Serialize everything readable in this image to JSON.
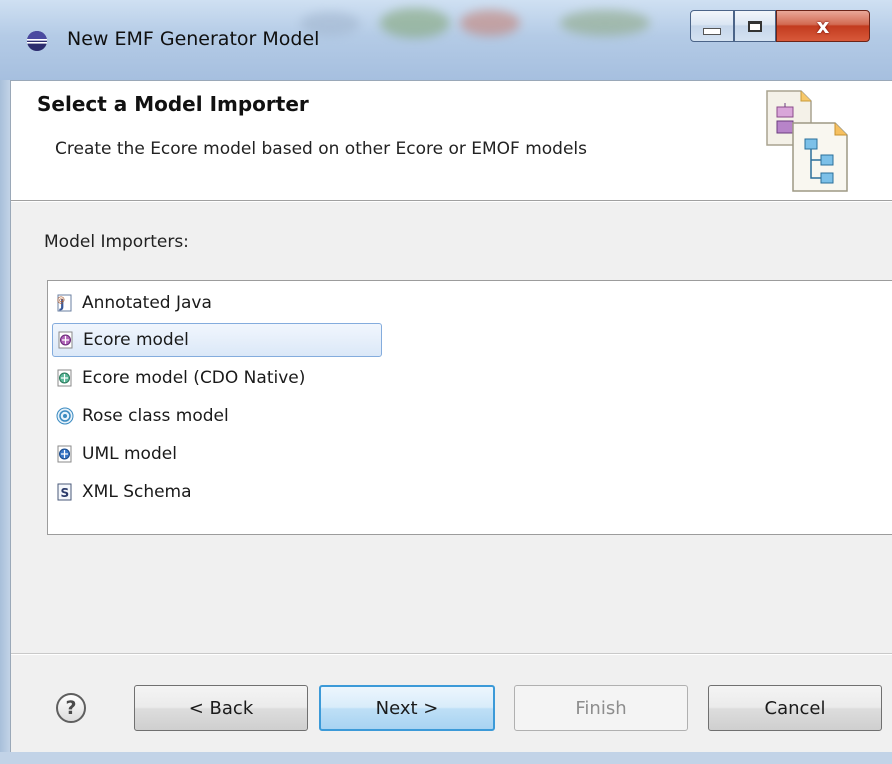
{
  "window": {
    "title": "New EMF Generator Model",
    "close_glyph": "x"
  },
  "banner": {
    "title": "Select a Model Importer",
    "description": "Create the Ecore model based on other Ecore or EMOF models",
    "icon": "model-import-wizard-icon"
  },
  "importers": {
    "label": "Model Importers:",
    "items": [
      {
        "label": "Annotated Java",
        "icon": "annotated-java-icon",
        "selected": false
      },
      {
        "label": "Ecore model",
        "icon": "ecore-model-icon",
        "selected": true
      },
      {
        "label": "Ecore model (CDO Native)",
        "icon": "ecore-cdo-icon",
        "selected": false
      },
      {
        "label": "Rose class model",
        "icon": "rose-model-icon",
        "selected": false
      },
      {
        "label": "UML model",
        "icon": "uml-model-icon",
        "selected": false
      },
      {
        "label": "XML Schema",
        "icon": "xml-schema-icon",
        "selected": false
      }
    ]
  },
  "buttons": {
    "help": "?",
    "back": "< Back",
    "next": "Next >",
    "finish": "Finish",
    "cancel": "Cancel",
    "finish_enabled": false
  },
  "colors": {
    "selection": "#dbe8f8",
    "default_button_border": "#3c9ad8",
    "close_button": "#c23b1f"
  }
}
